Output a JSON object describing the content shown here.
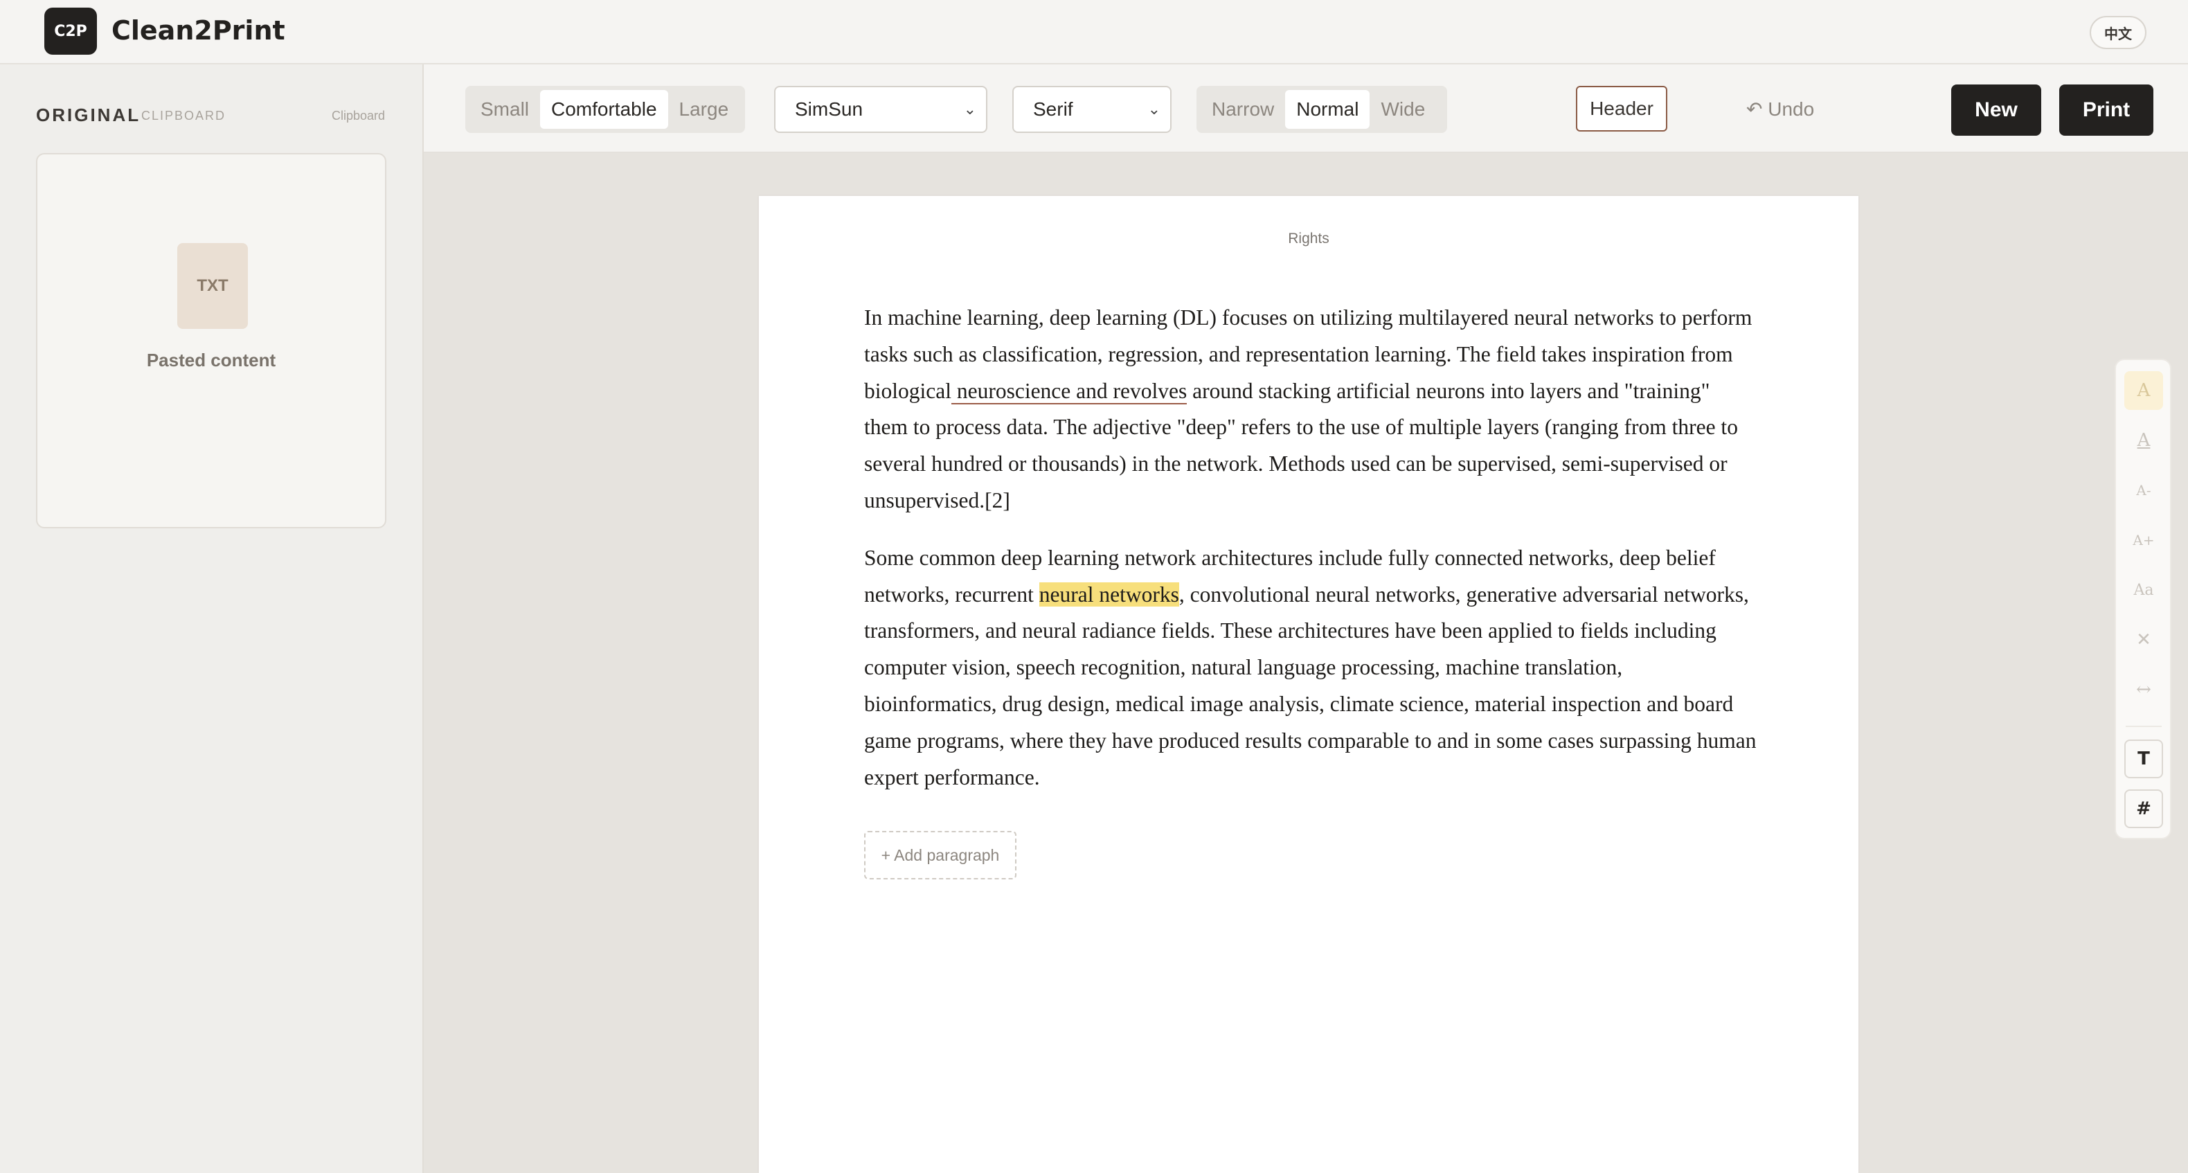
{
  "app": {
    "logo": "C2P",
    "title": "Clean2Print",
    "language_toggle": "中文"
  },
  "sidebar": {
    "title": "ORIGINAL",
    "subtitle": "CLIPBOARD",
    "link": "Clipboard",
    "source": {
      "icon_label": "TXT",
      "label": "Pasted content"
    }
  },
  "toolbar": {
    "density": {
      "options": [
        "Small",
        "Comfortable",
        "Large"
      ],
      "selected": "Comfortable"
    },
    "font_select": "SimSun",
    "family_select": "Serif",
    "width": {
      "options": [
        "Narrow",
        "Normal",
        "Wide"
      ],
      "selected": "Normal"
    },
    "undo_label": "Undo",
    "header_label": "Header",
    "new_label": "New",
    "print_label": "Print"
  },
  "document": {
    "running_head": "Rights",
    "p1": {
      "before": "In machine learning, deep learning (DL) focuses on utilizing multilayered neural networks to perform tasks such as classification, regression, and representation learning. The field takes inspiration from biological",
      "underlined": " neuroscience and revolves",
      "after": " around stacking artificial neurons into layers and \"training\" them to process data. The adjective \"deep\" refers to the use of multiple layers (ranging from three to several hundred or thousands) in the network. Methods used can be supervised, semi-supervised or unsupervised.[2]"
    },
    "p2": {
      "before": "Some common deep learning network architectures include fully connected networks, deep belief networks, recurrent ",
      "highlighted": "neural networks",
      "after": ", convolutional neural networks, generative adversarial networks, transformers, and neural radiance fields. These architectures have been applied to fields including computer vision, speech recognition, natural language processing, machine translation, bioinformatics, drug design, medical image analysis, climate science, material inspection and board game programs, where they have produced results comparable to and in some cases surpassing human expert performance."
    },
    "add_paragraph_label": "+ Add paragraph"
  },
  "float_tools": {
    "highlight": "A",
    "underline": "A",
    "shrink": "A-",
    "grow": "A+",
    "case": "Aa",
    "remove": "✕",
    "spacing": "↔",
    "text": "T",
    "heading": "#"
  }
}
